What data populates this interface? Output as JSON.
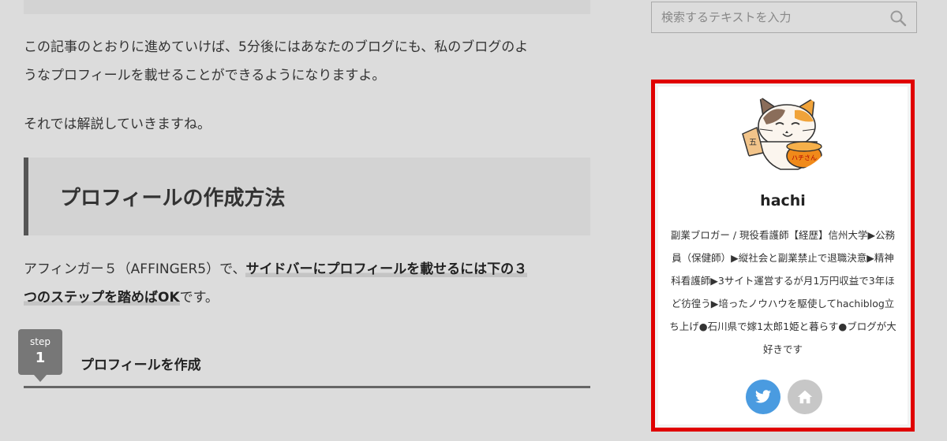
{
  "article": {
    "intro_line1": "この記事のとおりに進めていけば、5分後にはあなたのブログにも、私のブログのよ",
    "intro_line2": "うなプロフィールを載せることができるようになりますよ。",
    "transition": "それでは解説していきますね。",
    "heading": "プロフィールの作成方法",
    "lead_before": "アフィンガー５（AFFINGER5）で、",
    "lead_highlight_line1": "サイドバーにプロフィールを載せるには下の３",
    "lead_highlight_line2": "つのステップを踏めばOK",
    "lead_after": "です。",
    "step": {
      "word": "step",
      "number": "1",
      "title": "プロフィールを作成"
    }
  },
  "sidebar": {
    "search": {
      "placeholder": "検索するテキストを入力",
      "icon": "search-icon"
    },
    "profile": {
      "name": "hachi",
      "avatar_sign": "ハチさん",
      "avatar_badge": "五",
      "description": "副業ブロガー / 現役看護師【経歴】信州大学▶公務員（保健師）▶縦社会と副業禁止で退職決意▶精神科看護師▶3サイト運営するが月1万円収益で3年ほど彷徨う▶培ったノウハウを駆使してhachiblog立ち上げ●石川県で嫁1太郎1姫と暮らす●ブログが大好きです",
      "social": [
        {
          "icon": "twitter-icon",
          "color": "#4a9be0"
        },
        {
          "icon": "home-icon",
          "color": "#c7c7c7"
        }
      ],
      "highlight_color": "#e00000"
    }
  }
}
